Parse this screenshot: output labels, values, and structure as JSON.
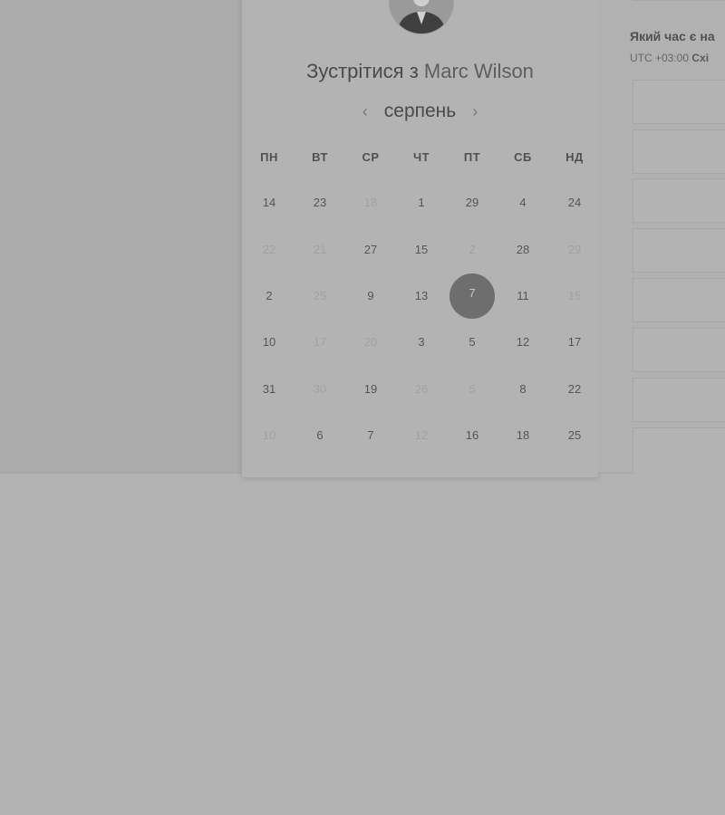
{
  "meeting": {
    "title_prefix": "Зустрітися з",
    "host_name": "Marc Wilson"
  },
  "calendar": {
    "month": "серпень",
    "prev_icon": "chevron-left-icon",
    "next_icon": "chevron-right-icon",
    "weekdays": [
      "ПН",
      "ВТ",
      "СР",
      "ЧТ",
      "ПТ",
      "СБ",
      "НД"
    ],
    "rows": [
      [
        {
          "d": "14",
          "muted": false
        },
        {
          "d": "23",
          "muted": false
        },
        {
          "d": "18",
          "muted": true
        },
        {
          "d": "1",
          "muted": false
        },
        {
          "d": "29",
          "muted": false
        },
        {
          "d": "4",
          "muted": false
        },
        {
          "d": "24",
          "muted": false
        }
      ],
      [
        {
          "d": "22",
          "muted": true
        },
        {
          "d": "21",
          "muted": true
        },
        {
          "d": "27",
          "muted": false
        },
        {
          "d": "15",
          "muted": false
        },
        {
          "d": "2",
          "muted": true
        },
        {
          "d": "28",
          "muted": false
        },
        {
          "d": "29",
          "muted": true
        }
      ],
      [
        {
          "d": "2",
          "muted": false
        },
        {
          "d": "25",
          "muted": true
        },
        {
          "d": "9",
          "muted": false
        },
        {
          "d": "13",
          "muted": false
        },
        {
          "d": "7",
          "muted": false,
          "selected": true
        },
        {
          "d": "11",
          "muted": false
        },
        {
          "d": "15",
          "muted": true
        }
      ],
      [
        {
          "d": "10",
          "muted": false
        },
        {
          "d": "17",
          "muted": true
        },
        {
          "d": "20",
          "muted": true
        },
        {
          "d": "3",
          "muted": false
        },
        {
          "d": "5",
          "muted": false
        },
        {
          "d": "12",
          "muted": false
        },
        {
          "d": "17",
          "muted": false
        }
      ],
      [
        {
          "d": "31",
          "muted": false
        },
        {
          "d": "30",
          "muted": true
        },
        {
          "d": "19",
          "muted": false
        },
        {
          "d": "26",
          "muted": true
        },
        {
          "d": "5",
          "muted": true
        },
        {
          "d": "8",
          "muted": false
        },
        {
          "d": "22",
          "muted": false
        }
      ],
      [
        {
          "d": "10",
          "muted": true
        },
        {
          "d": "6",
          "muted": false
        },
        {
          "d": "7",
          "muted": false
        },
        {
          "d": "12",
          "muted": true
        },
        {
          "d": "16",
          "muted": false
        },
        {
          "d": "18",
          "muted": false
        },
        {
          "d": "25",
          "muted": false
        }
      ]
    ]
  },
  "timezone": {
    "question": "Який час є на",
    "offset": "UTC +03:00",
    "zone_partial": "Схі"
  },
  "colors": {
    "overlay": "#b3b3b3",
    "selected_day": "#6e6e6e"
  }
}
